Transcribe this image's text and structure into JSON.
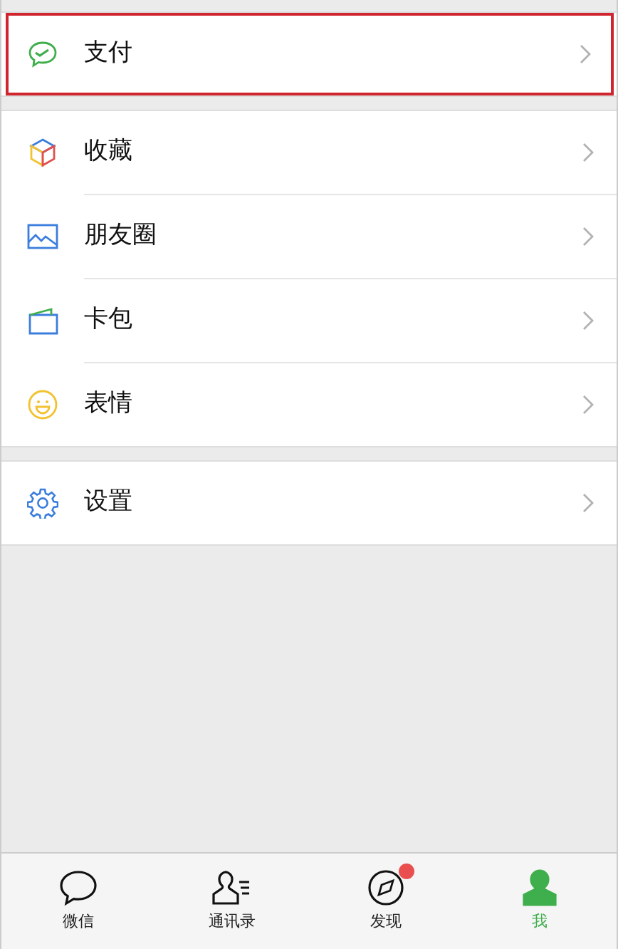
{
  "sections": [
    {
      "items": [
        {
          "label": "支付",
          "highlighted": true
        }
      ]
    },
    {
      "items": [
        {
          "label": "收藏",
          "highlighted": false
        },
        {
          "label": "朋友圈",
          "highlighted": false
        },
        {
          "label": "卡包",
          "highlighted": false
        },
        {
          "label": "表情",
          "highlighted": false
        }
      ]
    },
    {
      "items": [
        {
          "label": "设置",
          "highlighted": false
        }
      ]
    }
  ],
  "tab_bar": [
    {
      "label": "微信",
      "selected": false,
      "dot": false
    },
    {
      "label": "通讯录",
      "selected": false,
      "dot": false
    },
    {
      "label": "发现",
      "selected": false,
      "dot": true
    },
    {
      "label": "我",
      "selected": true,
      "dot": false
    }
  ]
}
